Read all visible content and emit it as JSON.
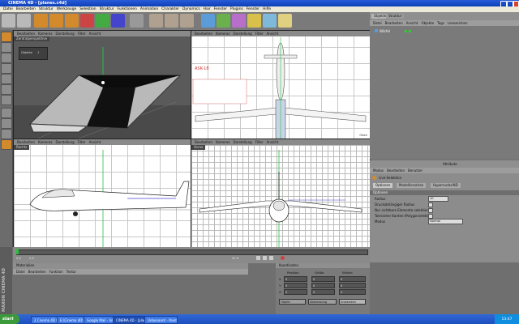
{
  "window": {
    "title": "CINEMA 4D - [planes.c4d]"
  },
  "menubar": [
    "Datei",
    "Bearbeiten",
    "Struktur",
    "Werkzeuge",
    "Selektion",
    "Struktur",
    "Funktionen",
    "Animation",
    "Charakter",
    "Dynamics",
    "Hair",
    "Fenster",
    "Plugins",
    "Fenster",
    "Hilfe"
  ],
  "viewports": {
    "perspective": {
      "menu": [
        "Bearbeiten",
        "Kameras",
        "Darstellung",
        "Filter",
        "Ansicht"
      ],
      "title": "Zentralperspektive",
      "tag_obj": "Objekte",
      "tag_num": "1"
    },
    "top": {
      "menu": [
        "Bearbeiten",
        "Kameras",
        "Darstellung",
        "Filter",
        "Ansicht"
      ],
      "sheet_title": "ASK-18",
      "footer": "Oben"
    },
    "right": {
      "menu": [
        "Bearbeiten",
        "Kameras",
        "Darstellung",
        "Filter",
        "Ansicht"
      ],
      "title": "Rechts"
    },
    "front": {
      "menu": [
        "Bearbeiten",
        "Kameras",
        "Darstellung",
        "Filter",
        "Ansicht"
      ],
      "title": "Vorne"
    }
  },
  "objects_panel": {
    "tabs": [
      "Objekte",
      "Struktur"
    ],
    "menu": [
      "Datei",
      "Bearbeiten",
      "Ansicht",
      "Objekte",
      "Tags",
      "Lesezeichen"
    ],
    "items": [
      {
        "name": "Würfel"
      }
    ]
  },
  "attributes_panel": {
    "header": "Attribute",
    "menu": [
      "Modus",
      "Bearbeiten",
      "Benutzer"
    ],
    "tool_name": "Live-Selektion",
    "tabs": [
      "Optionen",
      "Modellierachse",
      "Hypernurbs/ND"
    ],
    "section": "Optionen",
    "rows": [
      {
        "label": "Radius",
        "value": "10"
      },
      {
        "label": "Druckabhängiger Radius"
      },
      {
        "label": "Nur sichtbare Elemente selektieren"
      },
      {
        "label": "Toleranter Kanten-/Polygonselektion"
      },
      {
        "label": "Modus",
        "value": "Normal"
      }
    ]
  },
  "timeline": {
    "start": "0 B",
    "end": "90 B",
    "current": "0 B"
  },
  "materials": {
    "header": "Materialien",
    "menu": [
      "Datei",
      "Bearbeiten",
      "Funktion",
      "Textur"
    ]
  },
  "coordinates": {
    "header": "Koordinaten",
    "cols": [
      "Position",
      "Größe",
      "Winkel"
    ],
    "axes": [
      "X",
      "Y",
      "Z"
    ],
    "val": "0",
    "apply_mode": "Objekt",
    "size_mode": "Abmessung",
    "apply_label": "Anwenden"
  },
  "brand": "MAXON CINEMA 4D",
  "taskbar": {
    "start": "start",
    "tasks": [
      "2 Cinema 4D DIVMT...",
      "E:\\Cinema 4D\\SYMAT...",
      "Google Mail - Inbox - ...",
      "CINEMA 4D - [planes...",
      "Unbenannt - Paint"
    ],
    "clock": "13:47"
  },
  "colors": {
    "title_blue": "#1f4fcf",
    "accent_orange": "#e08a1e",
    "axis_green": "#23c04a"
  }
}
